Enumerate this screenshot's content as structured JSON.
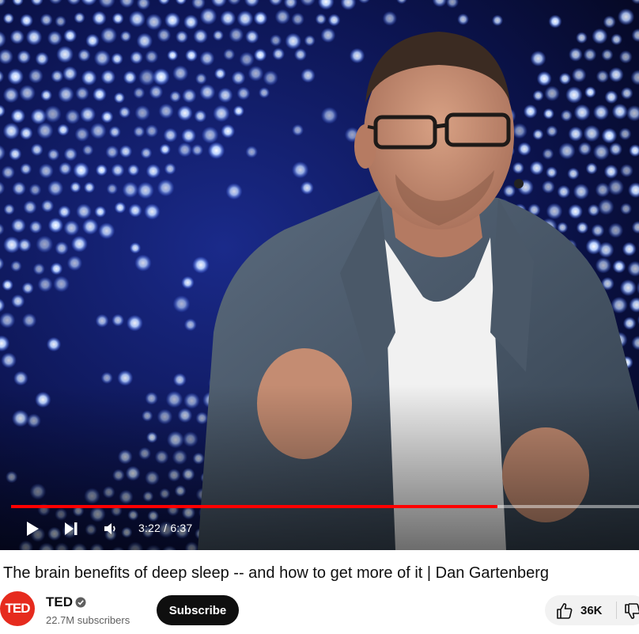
{
  "player": {
    "progress_fraction": 0.775,
    "time_display": "3:22 / 6:37",
    "accent_color": "#ff0000",
    "controls": {
      "play_icon": "play-icon",
      "next_icon": "next-icon",
      "volume_icon": "volume-icon"
    }
  },
  "video": {
    "title": "The brain benefits of deep sleep -- and how to get more of it | Dan Gartenberg"
  },
  "channel": {
    "avatar_text": "TED",
    "avatar_color": "#e62b1e",
    "name": "TED",
    "verified_icon": "verified-check-icon",
    "subscribers": "22.7M subscribers"
  },
  "actions": {
    "subscribe_label": "Subscribe",
    "like_count": "36K",
    "like_icon": "thumbs-up-icon",
    "dislike_icon": "thumbs-down-icon"
  }
}
